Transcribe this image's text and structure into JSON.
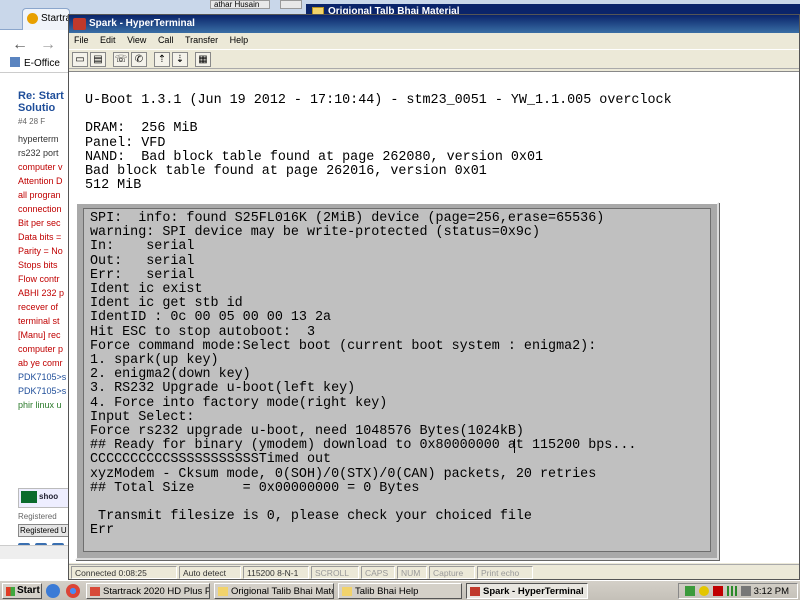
{
  "browser": {
    "tab_label": "Startra",
    "bg_title_athar": "athar Husain",
    "bg_folder_title": "Origional Talb Bhai Material",
    "bookmark": "E-Office",
    "post_title_1": "Re: Start",
    "post_title_2": "Solutio",
    "post_meta": "#4   28 F",
    "post_lines": [
      {
        "text": "hyperterm",
        "tone": "c-dark"
      },
      {
        "text": "rs232 port",
        "tone": "c-dark"
      },
      {
        "text": "computer v",
        "tone": "c-red"
      },
      {
        "text": "Attention D",
        "tone": "c-red"
      },
      {
        "text": "all progran",
        "tone": "c-red"
      },
      {
        "text": "connection",
        "tone": "c-red"
      },
      {
        "text": "Bit per sec",
        "tone": "c-red"
      },
      {
        "text": "Data bits =",
        "tone": "c-red"
      },
      {
        "text": "Parity = No",
        "tone": "c-red"
      },
      {
        "text": "Stops bits",
        "tone": "c-red"
      },
      {
        "text": "Flow contr",
        "tone": "c-red"
      },
      {
        "text": "ABHI 232 p",
        "tone": "c-red"
      },
      {
        "text": "recever of",
        "tone": "c-red"
      },
      {
        "text": "terminal st",
        "tone": "c-red"
      },
      {
        "text": "[Manu] rec",
        "tone": "c-red"
      },
      {
        "text": "computer p",
        "tone": "c-red"
      },
      {
        "text": "ab ye comr",
        "tone": "c-red"
      },
      {
        "text": "PDK7105>s",
        "tone": "c-blue"
      },
      {
        "text": "PDK7105>s",
        "tone": "c-blue"
      },
      {
        "text": "phir linux u",
        "tone": "c-green"
      }
    ],
    "flag_badge": "shoo",
    "registered_label": "Registered",
    "registered_button": "Registered U"
  },
  "terminal_window": {
    "title": "Spark - HyperTerminal",
    "menu": [
      "File",
      "Edit",
      "View",
      "Call",
      "Transfer",
      "Help"
    ],
    "toolbar_icons": [
      "new-icon",
      "open-icon",
      "phone-icon",
      "hangup-icon",
      "send-icon",
      "receive-icon",
      "properties-icon"
    ],
    "terminal_lines": [
      "U-Boot 1.3.1 (Jun 19 2012 - 17:10:44) - stm23_0051 - YW_1.1.005 overclock",
      "",
      "DRAM:  256 MiB",
      "Panel: VFD",
      "NAND:  Bad block table found at page 262080, version 0x01",
      "Bad block table found at page 262016, version 0x01",
      "512 MiB"
    ],
    "dialog_lines": [
      "SPI:  info: found S25FL016K (2MiB) device (page=256,erase=65536)",
      "warning: SPI device may be write-protected (status=0x9c)",
      "In:    serial",
      "Out:   serial",
      "Err:   serial",
      "Ident ic exist",
      "Ident ic get stb id",
      "IdentID : 0c 00 05 00 00 13 2a",
      "Hit ESC to stop autoboot:  3",
      "Force command mode:Select boot (current boot system : enigma2):",
      "1. spark(up key)",
      "2. enigma2(down key)",
      "3. RS232 Upgrade u-boot(left key)",
      "4. Force into factory mode(right key)",
      "Input Select:",
      "Force rs232 upgrade u-boot, need 1048576 Bytes(1024kB)",
      "## Ready for binary (ymodem) download to 0x80000000 at 115200 bps...",
      "CCCCCCCCCCSSSSSSSSSSSTimed out",
      "xyzModem - Cksum mode, 0(SOH)/0(STX)/0(CAN) packets, 20 retries",
      "## Total Size      = 0x00000000 = 0 Bytes",
      "",
      " Transmit filesize is 0, please check your choiced file",
      "Err"
    ],
    "status": {
      "connected": "Connected 0:08:25",
      "detect": "Auto detect",
      "params": "115200 8-N-1",
      "scroll": "SCROLL",
      "caps": "CAPS",
      "num": "NUM",
      "capture": "Capture",
      "print_echo": "Print echo"
    }
  },
  "taskbar": {
    "start": "Start",
    "tasks": [
      {
        "label": "Startrack 2020 HD Plus P...",
        "icon": "chrome-icon",
        "color": "#d84a38"
      },
      {
        "label": "Origional Talib Bhai Material",
        "icon": "folder-icon",
        "color": "#f2d36b"
      },
      {
        "label": "Talib Bhai Help",
        "icon": "folder-icon",
        "color": "#f2d36b"
      },
      {
        "label": "Spark - HyperTerminal",
        "icon": "hyperterminal-icon",
        "color": "#c0392b"
      }
    ],
    "clock": "3:12 PM"
  }
}
